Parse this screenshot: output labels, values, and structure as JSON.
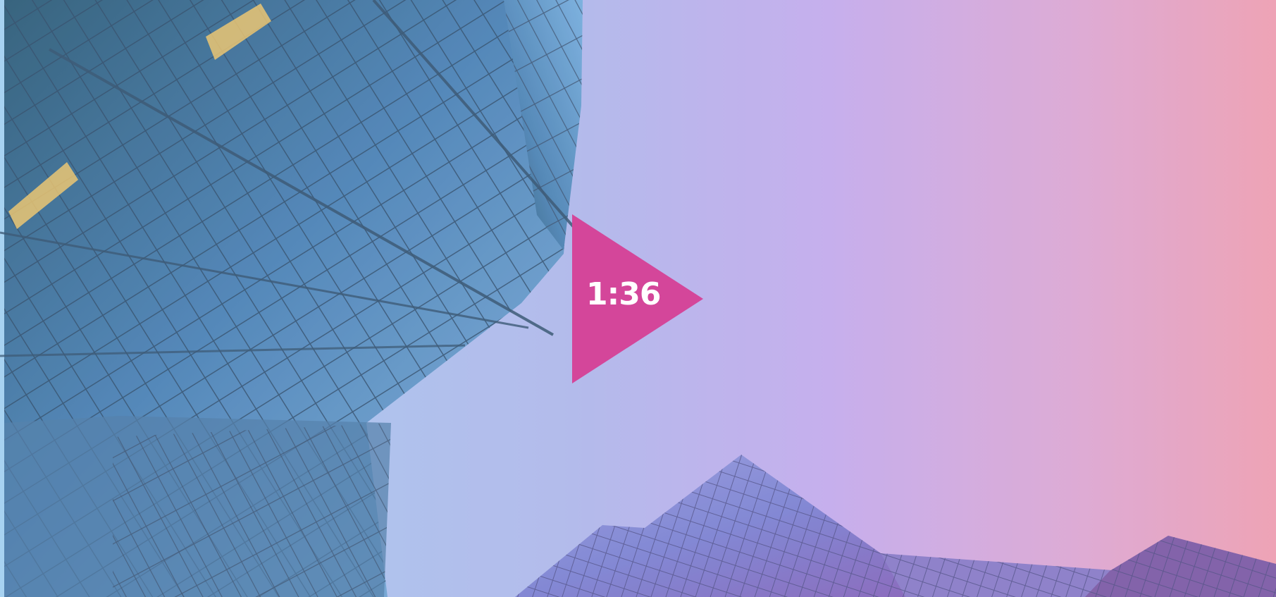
{
  "video": {
    "duration": "1:36",
    "play_color": "#d4469a",
    "icon": "play-icon"
  },
  "palette": {
    "sky_left": "#a9d4f0",
    "sky_mid": "#c9b2ee",
    "sky_right": "#f2a6b6",
    "glass_dark": "#2f5d78",
    "glass_light": "#7db2dc",
    "glass_purple": "#7d80d0",
    "frame_line": "#314b63",
    "warm_light": "#f0c96a"
  }
}
